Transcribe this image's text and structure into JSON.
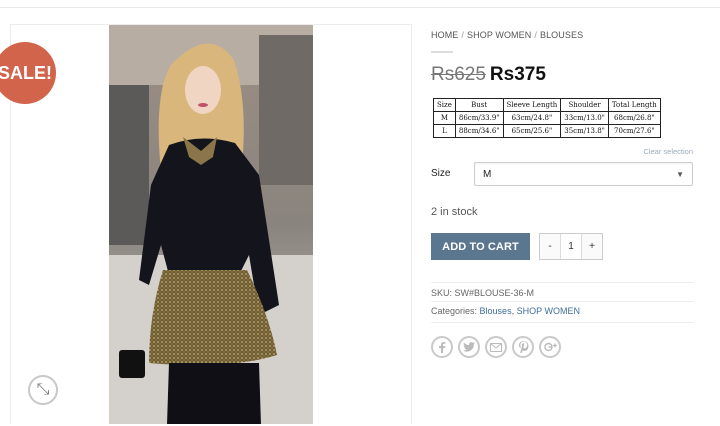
{
  "badge": {
    "sale": "SALE!"
  },
  "gallery": {
    "zoom_icon": "expand-arrows-icon"
  },
  "breadcrumb": {
    "home": "HOME",
    "sep": "/",
    "section": "SHOP WOMEN",
    "category": "BLOUSES"
  },
  "price": {
    "old": "Rs625",
    "new": "Rs375"
  },
  "size_chart": {
    "headers": [
      "Size",
      "Bust",
      "Sleeve Length",
      "Shoulder",
      "Total Length"
    ],
    "rows": [
      [
        "M",
        "86cm/33.9\"",
        "63cm/24.8\"",
        "33cm/13.0\"",
        "68cm/26.8\""
      ],
      [
        "L",
        "88cm/34.6\"",
        "65cm/25.6\"",
        "35cm/13.8\"",
        "70cm/27.6\""
      ]
    ]
  },
  "variation": {
    "clear_label": "Clear selection",
    "size_label": "Size",
    "size_value": "M"
  },
  "stock": "2 in stock",
  "cart": {
    "add_label": "ADD TO CART",
    "minus": "-",
    "qty": "1",
    "plus": "+"
  },
  "meta": {
    "sku_label": "SKU:",
    "sku_value": "SW#BLOUSE-36-M",
    "cat_label": "Categories:",
    "cat1": "Blouses",
    "comma": ",",
    "cat2": "SHOP WOMEN"
  },
  "share_icons": [
    "facebook-icon",
    "twitter-icon",
    "email-icon",
    "pinterest-icon",
    "google-plus-icon"
  ],
  "colors": {
    "sale_badge": "#d1644b",
    "add_to_cart": "#5b7790",
    "link": "#3f6e99",
    "dress_top": "#14141c",
    "peplum": "#7d6a3d"
  }
}
